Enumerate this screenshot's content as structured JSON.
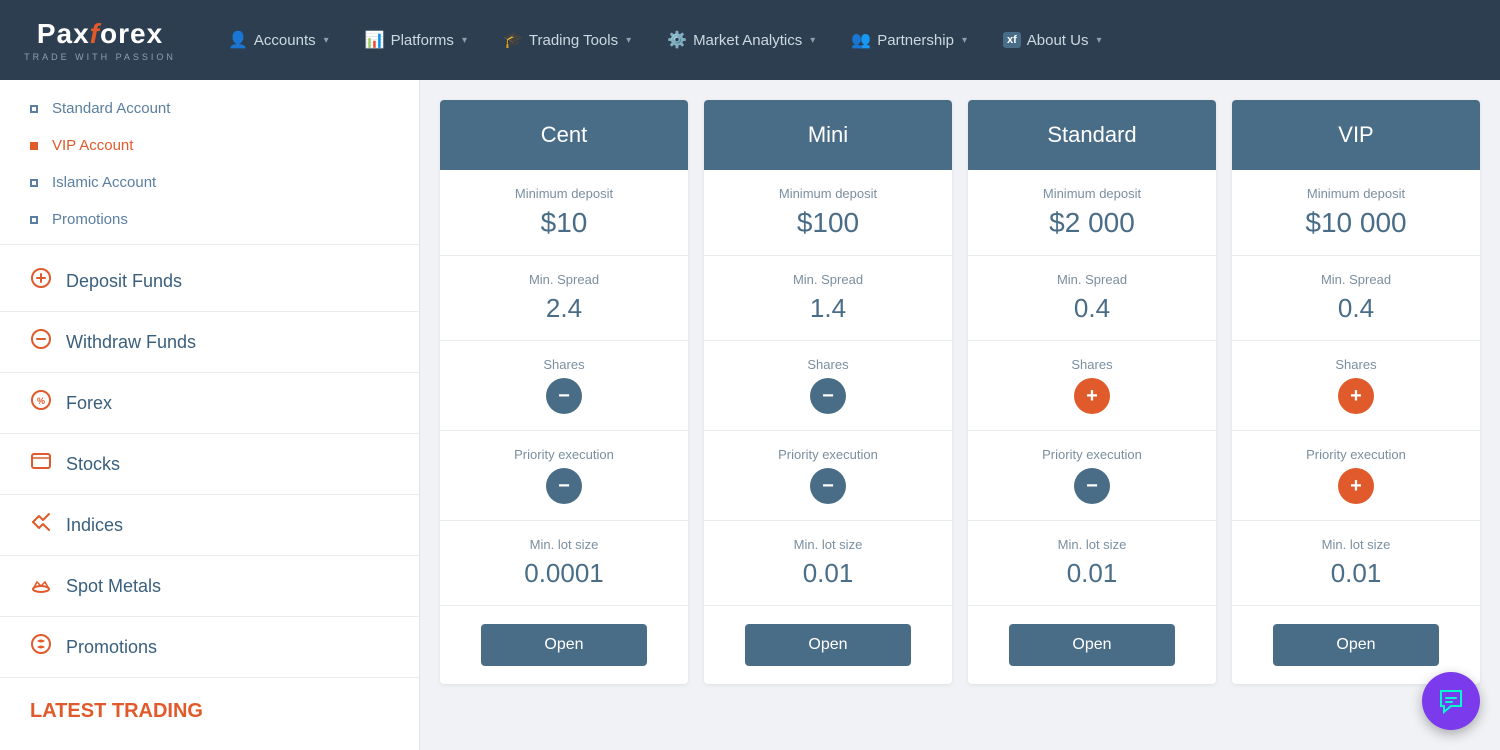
{
  "navbar": {
    "logo": {
      "pax": "Pax",
      "f": "f",
      "orex": "orex",
      "tagline": "TRADE WITH PASSION"
    },
    "items": [
      {
        "id": "accounts",
        "label": "Accounts",
        "icon": "👤",
        "hasChevron": true
      },
      {
        "id": "platforms",
        "label": "Platforms",
        "icon": "📊",
        "hasChevron": true
      },
      {
        "id": "trading-tools",
        "label": "Trading Tools",
        "icon": "🎓",
        "hasChevron": true
      },
      {
        "id": "market-analytics",
        "label": "Market Analytics",
        "icon": "⚙️",
        "hasChevron": true
      },
      {
        "id": "partnership",
        "label": "Partnership",
        "icon": "👥",
        "hasChevron": true
      },
      {
        "id": "about-us",
        "label": "About Us",
        "icon": "xf",
        "hasChevron": true
      }
    ]
  },
  "sidebar": {
    "sub_items": [
      {
        "id": "standard-account",
        "label": "Standard Account",
        "active": false
      },
      {
        "id": "vip-account",
        "label": "VIP Account",
        "active": true
      },
      {
        "id": "islamic-account",
        "label": "Islamic Account",
        "active": false
      },
      {
        "id": "promotions-sub",
        "label": "Promotions",
        "active": false
      }
    ],
    "main_items": [
      {
        "id": "deposit-funds",
        "label": "Deposit Funds",
        "icon": "💳"
      },
      {
        "id": "withdraw-funds",
        "label": "Withdraw Funds",
        "icon": "💳"
      },
      {
        "id": "forex",
        "label": "Forex",
        "icon": "%"
      },
      {
        "id": "stocks",
        "label": "Stocks",
        "icon": "🖥"
      },
      {
        "id": "indices",
        "label": "Indices",
        "icon": "✕"
      },
      {
        "id": "spot-metals",
        "label": "Spot Metals",
        "icon": "⛰"
      },
      {
        "id": "promotions",
        "label": "Promotions",
        "icon": "🔄"
      }
    ],
    "latest_trading": "LATEST\nTRADING"
  },
  "plans": [
    {
      "id": "cent",
      "header": "Cent",
      "min_deposit_label": "Minimum deposit",
      "min_deposit_value": "$10",
      "min_spread_label": "Min. Spread",
      "min_spread_value": "2.4",
      "shares_label": "Shares",
      "shares_type": "minus",
      "priority_label": "Priority execution",
      "priority_type": "minus",
      "lot_size_label": "Min. lot size",
      "lot_size_value": "0.0001",
      "open_btn": "Open"
    },
    {
      "id": "mini",
      "header": "Mini",
      "min_deposit_label": "Minimum deposit",
      "min_deposit_value": "$100",
      "min_spread_label": "Min. Spread",
      "min_spread_value": "1.4",
      "shares_label": "Shares",
      "shares_type": "minus",
      "priority_label": "Priority execution",
      "priority_type": "minus",
      "lot_size_label": "Min. lot size",
      "lot_size_value": "0.01",
      "open_btn": "Open"
    },
    {
      "id": "standard",
      "header": "Standard",
      "min_deposit_label": "Minimum deposit",
      "min_deposit_value": "$2 000",
      "min_spread_label": "Min. Spread",
      "min_spread_value": "0.4",
      "shares_label": "Shares",
      "shares_type": "plus",
      "priority_label": "Priority execution",
      "priority_type": "minus",
      "lot_size_label": "Min. lot size",
      "lot_size_value": "0.01",
      "open_btn": "Open"
    },
    {
      "id": "vip",
      "header": "VIP",
      "min_deposit_label": "Minimum deposit",
      "min_deposit_value": "$10 000",
      "min_spread_label": "Min. Spread",
      "min_spread_value": "0.4",
      "shares_label": "Shares",
      "shares_type": "plus",
      "priority_label": "Priority execution",
      "priority_type": "plus",
      "lot_size_label": "Min. lot size",
      "lot_size_value": "0.01",
      "open_btn": "Open"
    }
  ]
}
